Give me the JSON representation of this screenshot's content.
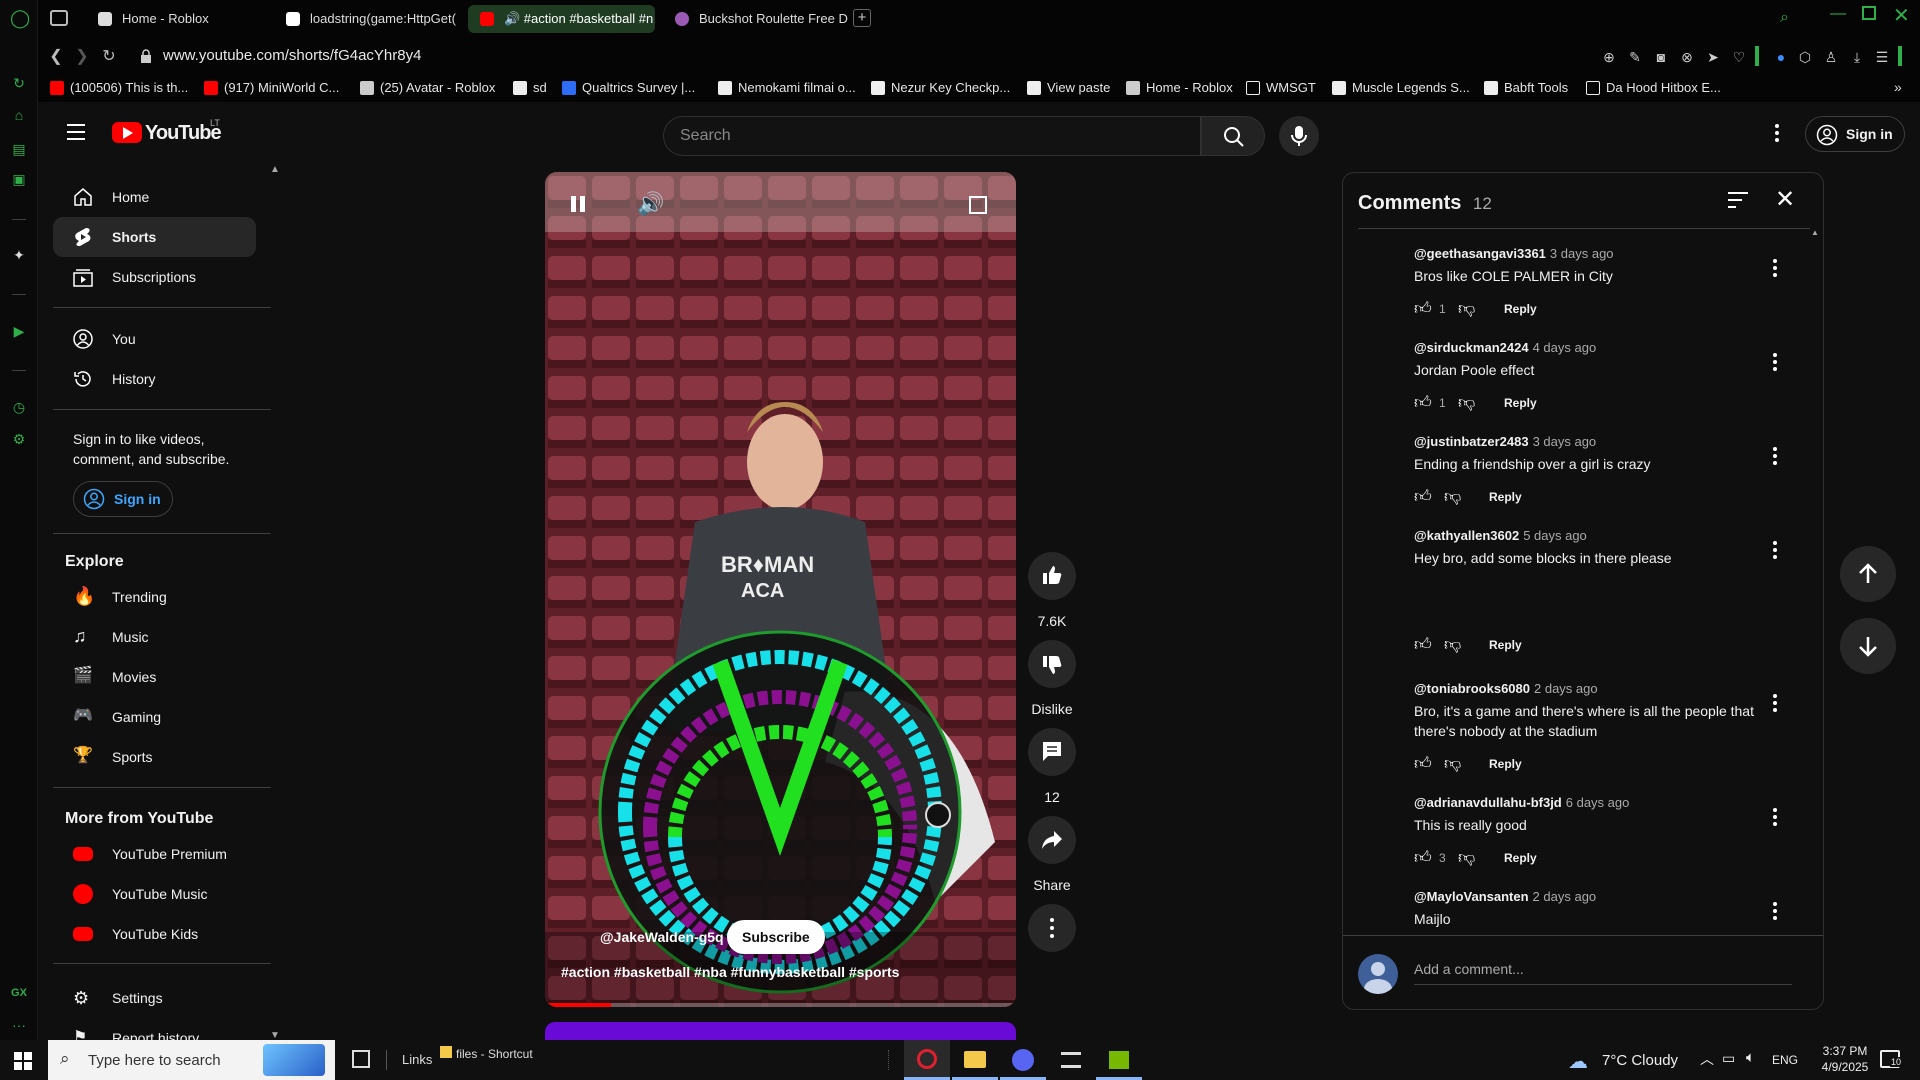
{
  "browser": {
    "tabs": [
      {
        "label": "Home - Roblox",
        "color": "#ffffff"
      },
      {
        "label": "loadstring(game:HttpGet(",
        "color": "#ffffff"
      },
      {
        "label": "🔊 #action #basketball #n",
        "color": "#ff0000",
        "active": true
      },
      {
        "label": "Buckshot Roulette Free D",
        "color": "#9b59b6"
      }
    ],
    "new_tab": "+",
    "url": "www.youtube.com/shorts/fG4acYhr8y4",
    "bookmarks": [
      {
        "label": "(100506) This is th...",
        "icon": "youtube-icon",
        "color": "#ff0000"
      },
      {
        "label": "(917) MiniWorld C...",
        "icon": "youtube-icon",
        "color": "#ff0000"
      },
      {
        "label": "(25) Avatar - Roblox",
        "icon": "roblox-icon",
        "color": "#cccccc"
      },
      {
        "label": "sd",
        "icon": "file-icon",
        "color": "#eeeeee"
      },
      {
        "label": "Qualtrics Survey |...",
        "icon": "xm-icon",
        "color": "#2e6cf6"
      },
      {
        "label": "Nemokami filmai o...",
        "icon": "file-icon",
        "color": "#eeeeee"
      },
      {
        "label": "Nezur Key Checkp...",
        "icon": "file-icon",
        "color": "#eeeeee"
      },
      {
        "label": "View paste",
        "icon": "file-icon",
        "color": "#eeeeee"
      },
      {
        "label": "Home - Roblox",
        "icon": "roblox-icon",
        "color": "#cccccc"
      },
      {
        "label": "WMSGT",
        "icon": "folder-icon",
        "color": "#eeeeee"
      },
      {
        "label": "Muscle Legends S...",
        "icon": "file-icon",
        "color": "#eeeeee"
      },
      {
        "label": "Babft Tools",
        "icon": "file-icon",
        "color": "#eeeeee"
      },
      {
        "label": "Da Hood Hitbox E...",
        "icon": "grid-icon",
        "color": "#eeeeee"
      }
    ]
  },
  "youtube": {
    "logo_text": "YouTube",
    "country": "LT",
    "search_placeholder": "Search",
    "sign_in": "Sign in",
    "guide": {
      "main": [
        "Home",
        "Shorts",
        "Subscriptions"
      ],
      "you": [
        "You",
        "History"
      ],
      "signin_prompt": "Sign in to like videos, comment, and subscribe.",
      "signin_button": "Sign in",
      "explore_title": "Explore",
      "explore": [
        "Trending",
        "Music",
        "Movies",
        "Gaming",
        "Sports"
      ],
      "more_title": "More from YouTube",
      "more": [
        "YouTube Premium",
        "YouTube Music",
        "YouTube Kids"
      ],
      "settings": [
        "Settings",
        "Report history"
      ]
    },
    "short": {
      "channel": "@JakeWalden-g5q",
      "subscribe": "Subscribe",
      "title": "#action #basketball #nba #funnybasketball #sports",
      "progress": 0.14,
      "likes": "7.6K",
      "dislike": "Dislike",
      "comment_count": "12",
      "share": "Share"
    },
    "comments_panel": {
      "title": "Comments",
      "count": "12",
      "add_placeholder": "Add a comment...",
      "reply_label": "Reply",
      "items": [
        {
          "author": "@geethasangavi3361",
          "time": "3 days ago",
          "text": "Bros like COLE PALMER in City",
          "likes": "1"
        },
        {
          "author": "@sirduckman2424",
          "time": "4 days ago",
          "text": "Jordan Poole effect",
          "likes": "1"
        },
        {
          "author": "@justinbatzer2483",
          "time": "3 days ago",
          "text": "Ending a friendship over a girl is crazy",
          "likes": ""
        },
        {
          "author": "@kathyallen3602",
          "time": "5 days ago",
          "text": "Hey bro, add some blocks in there please",
          "likes": ""
        },
        {
          "author": "@toniabrooks6080",
          "time": "2 days ago",
          "text": "Bro, it's a game and there's where is all the people that there's nobody at the stadium",
          "likes": ""
        },
        {
          "author": "@adrianavdullahu-bf3jd",
          "time": "6 days ago",
          "text": "This is really good",
          "likes": "3"
        },
        {
          "author": "@MayloVansanten",
          "time": "2 days ago",
          "text": "Maijlo",
          "likes": ""
        }
      ]
    }
  },
  "taskbar": {
    "search_placeholder": "Type here to search",
    "links_label": "Links",
    "files_label": "files - Shortcut",
    "weather": "7°C  Cloudy",
    "lang": "ENG",
    "time": "3:37 PM",
    "date": "4/9/2025",
    "notifications": "10"
  }
}
